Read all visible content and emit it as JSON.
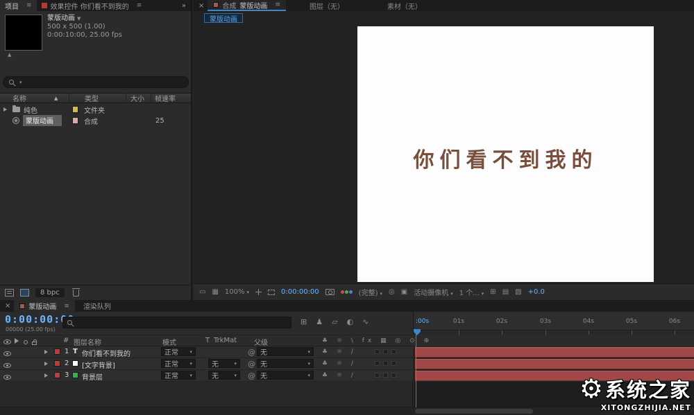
{
  "colors": {
    "timecode_blue": "#6cb4ff",
    "accent_blue": "#58a6e8",
    "bar_red": "#a04848",
    "label_red": "#c23b3b",
    "swatch_yellow": "#d6b94c",
    "swatch_rose": "#d9a8a8",
    "layer2_swatch": "#ffffff",
    "layer3_swatch": "#35b24a",
    "canvas_text_color": "#7a4e3c"
  },
  "project": {
    "tab_project": "项目",
    "tab_effects": "效果控件 你们看不到我的",
    "overflow": "»",
    "comp_name": "蒙版动画",
    "comp_size": "500 x 500 (1.00)",
    "comp_duration": "0:00:10:00, 25.00 fps",
    "col_name": "名称",
    "col_type": "类型",
    "col_size": "大小",
    "col_fps": "帧速率",
    "rows": [
      {
        "name": "纯色",
        "type": "文件夹",
        "fps": ""
      },
      {
        "name": "蒙版动画",
        "type": "合成",
        "fps": "25"
      }
    ],
    "bpc": "8 bpc"
  },
  "viewer": {
    "tab_comp_prefix": "合成",
    "tab_comp_name": "蒙版动画",
    "tab_layer": "图层（无）",
    "tab_footage": "素材（无）",
    "pill": "蒙版动画",
    "canvas_text": "你们看不到我的",
    "zoom": "100%",
    "timecode": "0:00:00:00",
    "resolution": "(完整)",
    "camera": "活动摄像机",
    "view_layout": "1 个...",
    "exposure": "+0.0"
  },
  "timeline": {
    "tab_comp": "蒙版动画",
    "tab_render_queue": "渲染队列",
    "timecode": "0:00:00:00",
    "frame_info": "00000 (25.00 fps)",
    "col_index": "#",
    "col_layer_name": "图层名称",
    "col_mode": "模式",
    "col_t": "T",
    "col_trkmat": "TrkMat",
    "col_parent": "父级",
    "switches_header": "♣ ☼ \\ fx ▦ ◎ ⊙ ⊕",
    "row_switches": "♣ ☼ /",
    "layers": [
      {
        "index": "1",
        "glyph": "T",
        "name": "你们看不到我的",
        "mode": "正常",
        "trkmat": "",
        "parent": "无"
      },
      {
        "index": "2",
        "glyph": "",
        "name": "[文字背景]",
        "mode": "正常",
        "trkmat": "无",
        "parent": "无"
      },
      {
        "index": "3",
        "glyph": "",
        "name": "背景层",
        "mode": "正常",
        "trkmat": "无",
        "parent": "无"
      }
    ],
    "ruler": [
      ":00s",
      "01s",
      "02s",
      "03s",
      "04s",
      "05s",
      "06s"
    ]
  },
  "watermark": {
    "site_name": "系统之家",
    "site_url": "XITONGZHIJIA.NET"
  }
}
